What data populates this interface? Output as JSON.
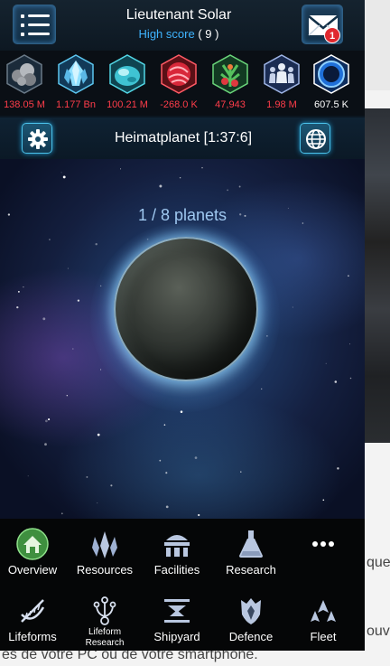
{
  "background_page": {
    "text_1": "que d",
    "text_2": "ouv",
    "text_3": "es de votre PC ou de votre smartphone."
  },
  "header": {
    "player_name": "Lieutenant Solar",
    "score_label": "High score",
    "score_value": "( 9 )",
    "unread_messages": "1"
  },
  "resources": [
    {
      "icon": "metal-icon",
      "value": "138.05 M",
      "color": "#ff3d4a"
    },
    {
      "icon": "crystal-icon",
      "value": "1.177 Bn",
      "color": "#ff3d4a"
    },
    {
      "icon": "deuterium-icon",
      "value": "100.21 M",
      "color": "#ff3d4a"
    },
    {
      "icon": "energy-icon",
      "value": "-268.0 K",
      "color": "#ff3d4a"
    },
    {
      "icon": "food-icon",
      "value": "47,943",
      "color": "#ff3d4a"
    },
    {
      "icon": "population-icon",
      "value": "1.98 M",
      "color": "#ff3d4a"
    },
    {
      "icon": "dark-matter-icon",
      "value": "607.5 K",
      "color": "#ffffff"
    }
  ],
  "planet_bar": {
    "planet_name": "Heimatplanet [1:37:6]"
  },
  "space_view": {
    "planets_count": "1 / 8 planets"
  },
  "nav": {
    "row1": [
      {
        "label": "Overview",
        "icon": "home-icon"
      },
      {
        "label": "Resources",
        "icon": "crystals-icon"
      },
      {
        "label": "Facilities",
        "icon": "facility-icon"
      },
      {
        "label": "Research",
        "icon": "flask-icon"
      },
      {
        "label": "",
        "icon": "more-icon"
      }
    ],
    "row2": [
      {
        "label": "Lifeforms",
        "icon": "dna-icon"
      },
      {
        "label": "Lifeform Research",
        "icon": "lifeform-research-icon"
      },
      {
        "label": "Shipyard",
        "icon": "shipyard-icon"
      },
      {
        "label": "Defence",
        "icon": "shield-icon"
      },
      {
        "label": "Fleet",
        "icon": "fleet-icon"
      }
    ]
  }
}
